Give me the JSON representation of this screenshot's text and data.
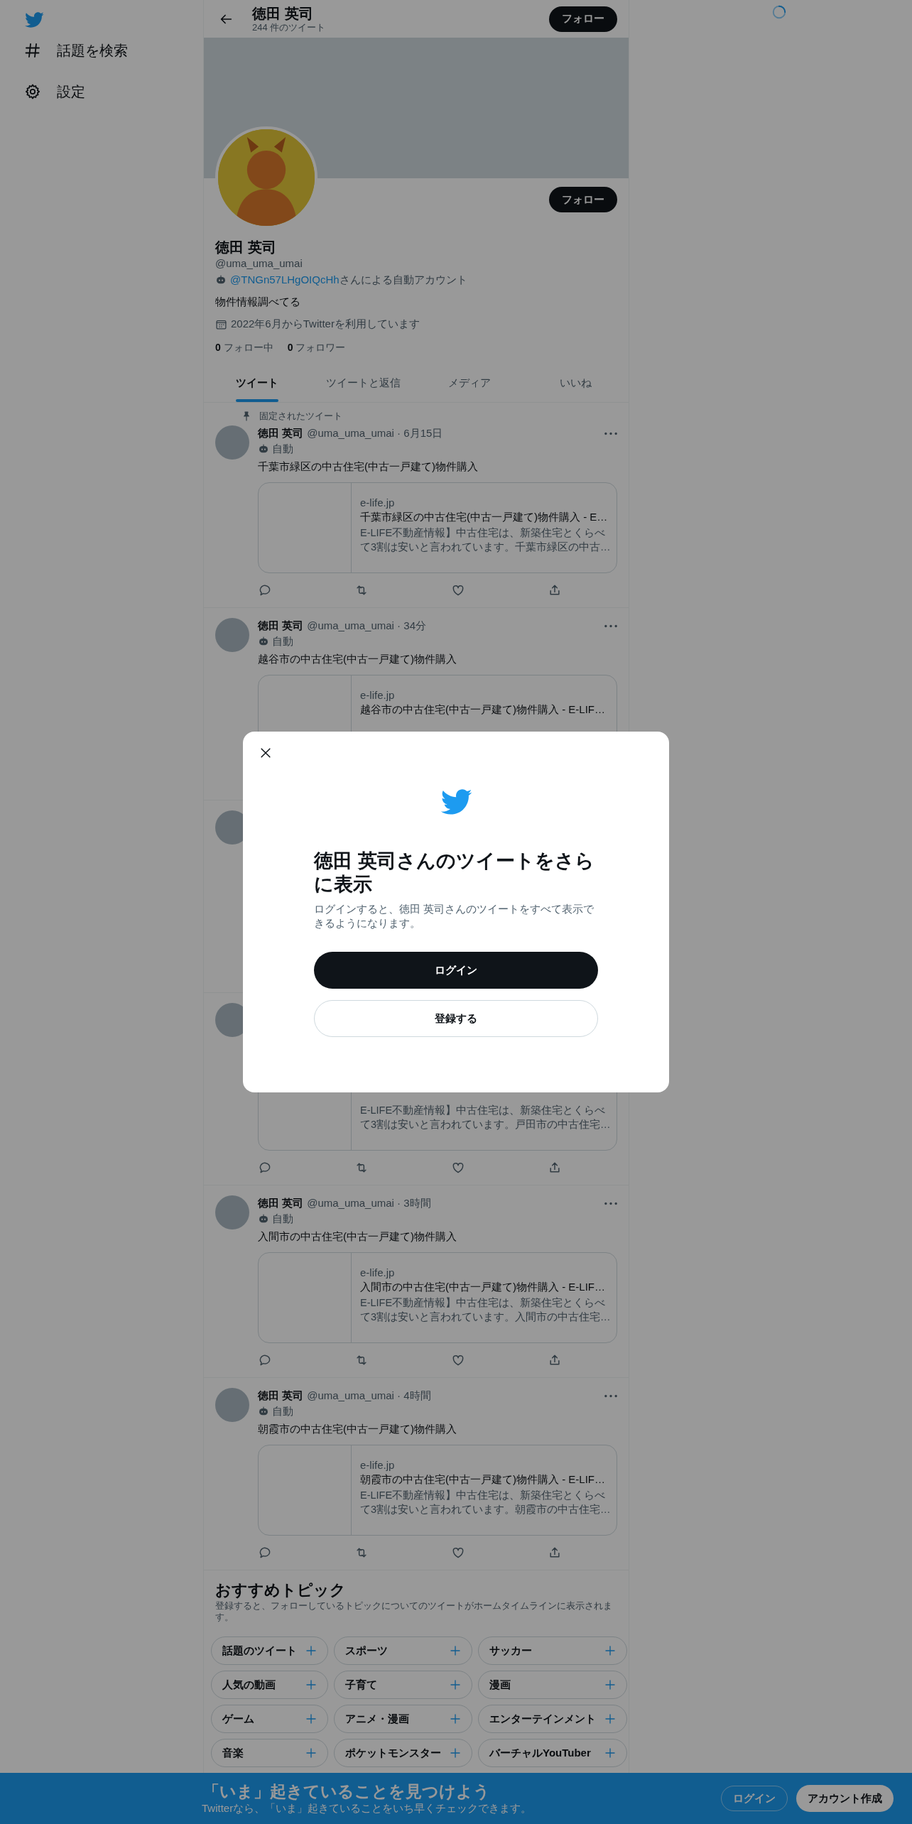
{
  "sidebar": {
    "items": [
      {
        "kind": "explore",
        "label": "話題を検索"
      },
      {
        "kind": "settings",
        "label": "設定"
      }
    ]
  },
  "header": {
    "name": "徳田 英司",
    "tweet_count": "244 件のツイート",
    "follow_button": "フォロー"
  },
  "profile": {
    "follow_button": "フォロー",
    "name": "徳田 英司",
    "handle": "@uma_uma_umai",
    "automated_by": {
      "link": "@TNGn57LHgOIQcHh",
      "suffix": "さんによる自動アカウント"
    },
    "bio": "物件情報調べてる",
    "joined": "2022年6月からTwitterを利用しています",
    "following": "**0** フォロー中",
    "followers": "**0** フォロワー"
  },
  "tabs": [
    {
      "label": "ツイート",
      "selected": true
    },
    {
      "label": "ツイートと返信",
      "selected": false
    },
    {
      "label": "メディア",
      "selected": false
    },
    {
      "label": "いいね",
      "selected": false
    }
  ],
  "tweets": [
    {
      "kind": "tweet",
      "pinned_label": "固定されたツイート",
      "name": "徳田 英司",
      "meta": "@uma_uma_umai · 6月15日",
      "automated_label": "自動",
      "text": "千葉市緑区の中古住宅(中古一戸建て)物件購入",
      "card": {
        "domain": "e-life.jp",
        "title": "千葉市緑区の中古住宅(中古一戸建て)物件購入 - E…",
        "description": "E-LIFE不動産情報】中古住宅は、新築住宅とくらべて3割は安いと言われています。千葉市緑区の中古…"
      },
      "actions": true
    },
    {
      "kind": "tweet",
      "name": "徳田 英司",
      "meta": "@uma_uma_umai · 34分",
      "automated_label": "自動",
      "text": "越谷市の中古住宅(中古一戸建て)物件購入",
      "card": {
        "domain": "e-life.jp",
        "title": "越谷市の中古住宅(中古一戸建て)物件購入 - E-LIF…"
      }
    },
    {
      "kind": "tweet"
    },
    {
      "kind": "tweet",
      "card": {
        "description": "E-LIFE不動産情報】中古住宅は、新築住宅とくらべて3割は安いと言われています。戸田市の中古住宅…"
      },
      "actions": true
    },
    {
      "kind": "tweet",
      "name": "徳田 英司",
      "meta": "@uma_uma_umai · 3時間",
      "automated_label": "自動",
      "text": "入間市の中古住宅(中古一戸建て)物件購入",
      "card": {
        "domain": "e-life.jp",
        "title": "入間市の中古住宅(中古一戸建て)物件購入 - E-LIF…",
        "description": "E-LIFE不動産情報】中古住宅は、新築住宅とくらべて3割は安いと言われています。入間市の中古住宅…"
      },
      "actions": true
    },
    {
      "kind": "tweet",
      "name": "徳田 英司",
      "meta": "@uma_uma_umai · 4時間",
      "automated_label": "自動",
      "text": "朝霞市の中古住宅(中古一戸建て)物件購入",
      "card": {
        "domain": "e-life.jp",
        "title": "朝霞市の中古住宅(中古一戸建て)物件購入 - E-LIF…",
        "description": "E-LIFE不動産情報】中古住宅は、新築住宅とくらべて3割は安いと言われています。朝霞市の中古住宅…"
      },
      "actions": true
    }
  ],
  "topics": {
    "title": "おすすめトピック",
    "description": "登録すると、フォローしているトピックについてのツイートがホームタイムラインに表示されます。",
    "items": [
      "話題のツイート",
      "スポーツ",
      "サッカー",
      "人気の動画",
      "子育て",
      "漫画",
      "ゲーム",
      "アニメ・漫画",
      "エンターテインメント",
      "音楽",
      "ポケットモンスター",
      "バーチャルYouTuber"
    ]
  },
  "modal": {
    "title": "徳田 英司さんのツイートをさらに表示",
    "description": "ログインすると、徳田 英司さんのツイートをすべて表示できるようになります。",
    "login_button": "ログイン",
    "signup_button": "登録する"
  },
  "bottom_bar": {
    "title": "「いま」起きていることを見つけよう",
    "subtitle": "Twitterなら、「いま」起きていることをいち早くチェックできます。",
    "login_button": "ログイン",
    "signup_button": "アカウント作成"
  }
}
